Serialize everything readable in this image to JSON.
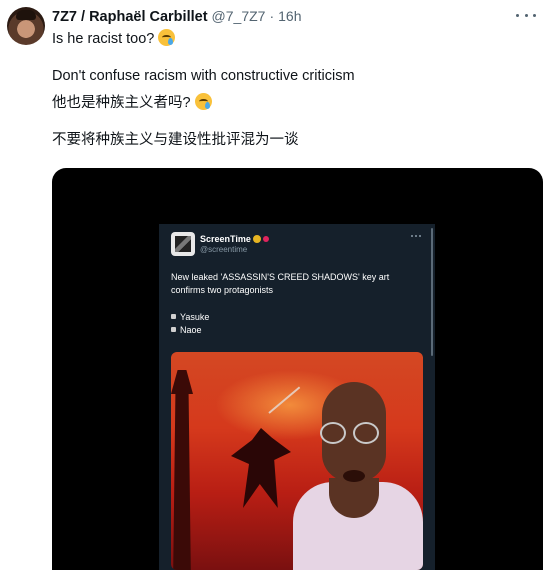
{
  "tweet": {
    "author_name": "7Z7 / Raphaël Carbillet",
    "handle": "@7_7Z7",
    "separator": "·",
    "time": "16h",
    "lines": [
      "Is he racist too?",
      "Don't confuse racism with constructive criticism",
      "他也是种族主义者吗?",
      "不要将种族主义与建设性批评混为一谈"
    ]
  },
  "embedded_tweet": {
    "name": "ScreenTime",
    "handle": "@screentime",
    "text_line1": "New leaked 'ASSASSIN'S CREED SHADOWS' key art",
    "text_line2": "confirms two protagonists",
    "bullets": [
      "Yasuke",
      "Naoe"
    ]
  },
  "icons": {
    "more": "more-horizontal-icon",
    "emoji": "face-holding-back-tears-emoji",
    "verified": "gold-verified-badge"
  },
  "colors": {
    "text": "#0f1419",
    "muted": "#536471",
    "media_bg": "#000000",
    "inner_bg": "#15202b"
  }
}
